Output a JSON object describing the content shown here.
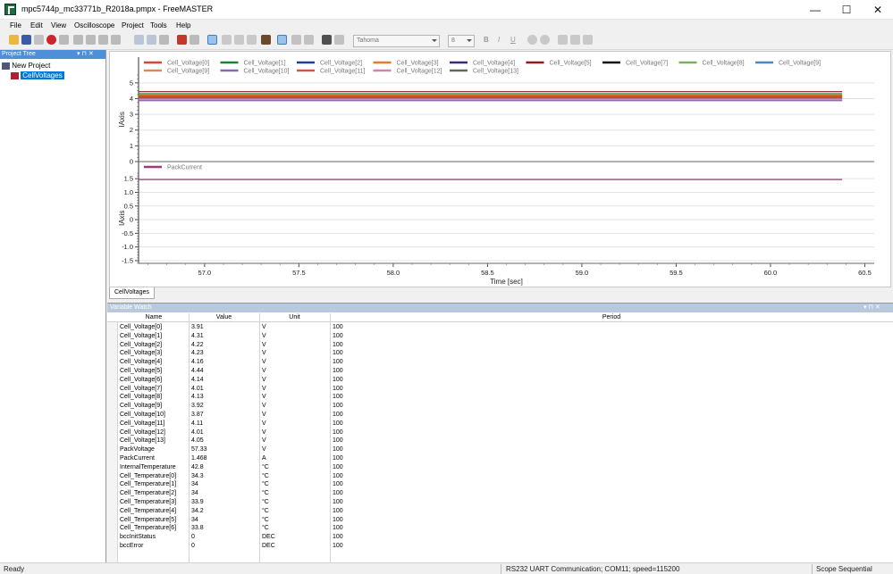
{
  "window": {
    "title": "mpc5744p_mc33771b_R2018a.pmpx - FreeMASTER",
    "minimize": "—",
    "maximize": "☐",
    "close": "✕"
  },
  "menu": [
    "File",
    "Edit",
    "View",
    "Oscilloscope",
    "Project",
    "Tools",
    "Help"
  ],
  "toolbar": {
    "font_name": "Tahoma",
    "font_size": "8",
    "bold": "B",
    "italic": "I",
    "underline": "U"
  },
  "project_tree": {
    "title": "Project Tree",
    "controls": "▾ ⊓ ✕",
    "root": "New Project",
    "child": "CellVoltages"
  },
  "scope_tab": "CellVoltages",
  "colors": {
    "Cell_Voltage[0]": "#d3483b",
    "Cell_Voltage[1]": "#1a8040",
    "Cell_Voltage[2]": "#213f8f",
    "Cell_Voltage[3]": "#e37c2d",
    "Cell_Voltage[4]": "#3a2b7a",
    "Cell_Voltage[5]": "#8a1c1c",
    "Cell_Voltage[7]": "#111111",
    "Cell_Voltage[8]": "#7bb063",
    "Cell_Voltage[9]": "#4e86c6",
    "Cell_Voltage[9b]": "#d58d56",
    "Cell_Voltage[10]": "#8668b8",
    "Cell_Voltage[11]": "#c35d44",
    "Cell_Voltage[12]": "#d482b4",
    "Cell_Voltage[13]": "#5b6b5e",
    "PackCurrent": "#9c3c7a"
  },
  "chart_data": [
    {
      "type": "line",
      "ylabel": "IAxis",
      "xlabel": "",
      "ylim": [
        0,
        5.5
      ],
      "yticks": [
        "0",
        "1",
        "2",
        "3",
        "4",
        "5"
      ],
      "xlim": [
        56.65,
        60.55
      ],
      "grid": true,
      "legend": "top",
      "series": [
        {
          "name": "Cell_Voltage[0]",
          "values": [
            3.91,
            3.91
          ],
          "color": "#d3483b"
        },
        {
          "name": "Cell_Voltage[1]",
          "values": [
            4.31,
            4.31
          ],
          "color": "#1a8040"
        },
        {
          "name": "Cell_Voltage[2]",
          "values": [
            4.22,
            4.22
          ],
          "color": "#213f8f"
        },
        {
          "name": "Cell_Voltage[3]",
          "values": [
            4.23,
            4.23
          ],
          "color": "#e37c2d"
        },
        {
          "name": "Cell_Voltage[4]",
          "values": [
            4.16,
            4.16
          ],
          "color": "#3a2b7a"
        },
        {
          "name": "Cell_Voltage[5]",
          "values": [
            4.44,
            4.44
          ],
          "color": "#8a1c1c"
        },
        {
          "name": "Cell_Voltage[7]",
          "values": [
            4.01,
            4.01
          ],
          "color": "#111111"
        },
        {
          "name": "Cell_Voltage[8]",
          "values": [
            4.13,
            4.13
          ],
          "color": "#7bb063"
        },
        {
          "name": "Cell_Voltage[9]",
          "values": [
            3.92,
            3.92
          ],
          "color": "#4e86c6"
        },
        {
          "name": "Cell_Voltage[9]",
          "values": [
            3.92,
            3.92
          ],
          "color": "#d58d56"
        },
        {
          "name": "Cell_Voltage[10]",
          "values": [
            3.87,
            3.87
          ],
          "color": "#8668b8"
        },
        {
          "name": "Cell_Voltage[11]",
          "values": [
            4.11,
            4.11
          ],
          "color": "#c35d44"
        },
        {
          "name": "Cell_Voltage[12]",
          "values": [
            4.01,
            4.01
          ],
          "color": "#d482b4"
        },
        {
          "name": "Cell_Voltage[13]",
          "values": [
            4.05,
            4.05
          ],
          "color": "#5b6b5e"
        }
      ],
      "x": [
        56.65,
        60.38
      ]
    },
    {
      "type": "line",
      "ylabel": "IAxis",
      "xlabel": "Time [sec]",
      "ylim": [
        -1.6,
        1.8
      ],
      "yticks": [
        "-1.5",
        "-1.0",
        "-0.5",
        "0",
        "0.5",
        "1.0",
        "1.5"
      ],
      "xticks": [
        "57.0",
        "57.5",
        "58.0",
        "58.5",
        "59.0",
        "59.5",
        "60.0",
        "60.5"
      ],
      "xlim": [
        56.65,
        60.55
      ],
      "grid": true,
      "legend": "top-left",
      "series": [
        {
          "name": "PackCurrent",
          "values": [
            1.468,
            1.468
          ],
          "color": "#9c3c7a"
        }
      ],
      "x": [
        56.65,
        60.38
      ]
    }
  ],
  "variable_watch": {
    "title": "Variable Watch",
    "controls": "▾ ⊓ ✕",
    "columns": [
      "Name",
      "Value",
      "Unit",
      "Period"
    ],
    "rows": [
      [
        "Cell_Voltage[0]",
        "3.91",
        "V",
        "100"
      ],
      [
        "Cell_Voltage[1]",
        "4.31",
        "V",
        "100"
      ],
      [
        "Cell_Voltage[2]",
        "4.22",
        "V",
        "100"
      ],
      [
        "Cell_Voltage[3]",
        "4.23",
        "V",
        "100"
      ],
      [
        "Cell_Voltage[4]",
        "4.16",
        "V",
        "100"
      ],
      [
        "Cell_Voltage[5]",
        "4.44",
        "V",
        "100"
      ],
      [
        "Cell_Voltage[6]",
        "4.14",
        "V",
        "100"
      ],
      [
        "Cell_Voltage[7]",
        "4.01",
        "V",
        "100"
      ],
      [
        "Cell_Voltage[8]",
        "4.13",
        "V",
        "100"
      ],
      [
        "Cell_Voltage[9]",
        "3.92",
        "V",
        "100"
      ],
      [
        "Cell_Voltage[10]",
        "3.87",
        "V",
        "100"
      ],
      [
        "Cell_Voltage[11]",
        "4.11",
        "V",
        "100"
      ],
      [
        "Cell_Voltage[12]",
        "4.01",
        "V",
        "100"
      ],
      [
        "Cell_Voltage[13]",
        "4.05",
        "V",
        "100"
      ],
      [
        "PackVoltage",
        "57.33",
        "V",
        "100"
      ],
      [
        "PackCurrent",
        "1.468",
        "A",
        "100"
      ],
      [
        "InternalTemperature",
        "42.8",
        "°C",
        "100"
      ],
      [
        "Cell_Temperature[0]",
        "34.3",
        "°C",
        "100"
      ],
      [
        "Cell_Temperature[1]",
        "34",
        "°C",
        "100"
      ],
      [
        "Cell_Temperature[2]",
        "34",
        "°C",
        "100"
      ],
      [
        "Cell_Temperature[3]",
        "33.9",
        "°C",
        "100"
      ],
      [
        "Cell_Temperature[4]",
        "34.2",
        "°C",
        "100"
      ],
      [
        "Cell_Temperature[5]",
        "34",
        "°C",
        "100"
      ],
      [
        "Cell_Temperature[6]",
        "33.8",
        "°C",
        "100"
      ],
      [
        "bccInitStatus",
        "0",
        "DEC",
        "100"
      ],
      [
        "bccError",
        "0",
        "DEC",
        "100"
      ]
    ]
  },
  "status": {
    "left": "Ready",
    "middle": "RS232 UART Communication; COM11; speed=115200",
    "right": "Scope Sequential"
  }
}
